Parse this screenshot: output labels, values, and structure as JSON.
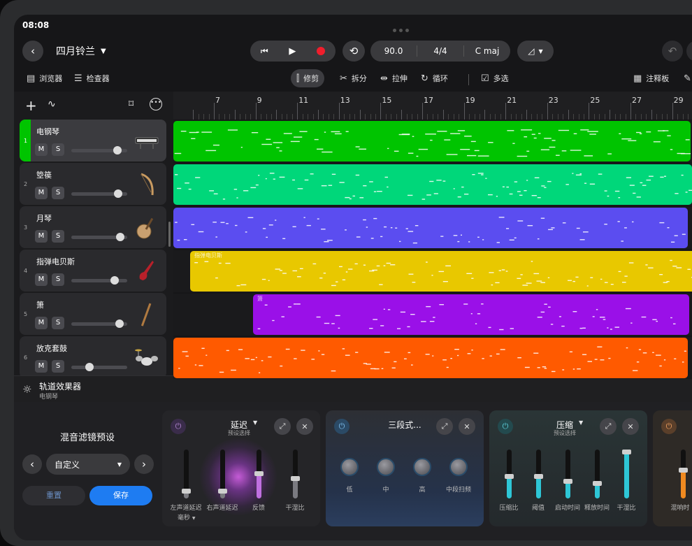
{
  "status": {
    "time": "08:08"
  },
  "project": {
    "title": "四月铃兰"
  },
  "transport": {
    "tempo": "90.0",
    "signature": "4/4",
    "key": "C maj"
  },
  "toolbar": {
    "browser": "浏览器",
    "inspector": "检查器",
    "trim": "修剪",
    "split": "拆分",
    "stretch": "拉伸",
    "loop": "循环",
    "multiselect": "多选",
    "notes": "注释板"
  },
  "ruler": {
    "bars": [
      "7",
      "9",
      "11",
      "13",
      "15",
      "17",
      "19",
      "21",
      "23",
      "25",
      "27",
      "29"
    ]
  },
  "tracks": [
    {
      "num": "1",
      "name": "电钢琴",
      "color": "#00c400",
      "volume": 0.82,
      "selected": true
    },
    {
      "num": "2",
      "name": "箜篌",
      "color": "#00d77a",
      "volume": 0.84
    },
    {
      "num": "3",
      "name": "月琴",
      "color": "#5b4df0",
      "volume": 0.88
    },
    {
      "num": "4",
      "name": "指弹电贝斯",
      "color": "#e8c800",
      "volume": 0.78
    },
    {
      "num": "5",
      "name": "箫",
      "color": "#9a10e8",
      "volume": 0.86
    },
    {
      "num": "6",
      "name": "放克套鼓",
      "color": "#ff5a00",
      "volume": 0.32
    }
  ],
  "track_buttons": {
    "mute": "M",
    "solo": "S"
  },
  "clips": [
    {
      "label": ""
    },
    {
      "label": ""
    },
    {
      "label": ""
    },
    {
      "label": "指弹电贝斯"
    },
    {
      "label": "箫"
    },
    {
      "label": ""
    }
  ],
  "fx": {
    "header_title": "轨道效果器",
    "header_sub": "电钢琴",
    "preset_title": "混音滤镜预设",
    "preset_value": "自定义",
    "reset": "重置",
    "save": "保存",
    "delay": {
      "title": "延迟",
      "sub": "预设选择",
      "labels": [
        "左声道延迟",
        "右声道延迟",
        "反馈",
        "干湿比"
      ],
      "unit": "毫秒",
      "levels": [
        0.15,
        0.15,
        0.5,
        0.4
      ]
    },
    "eq": {
      "title": "三段式...",
      "labels": [
        "低",
        "中",
        "高",
        "中段扫频"
      ]
    },
    "comp": {
      "title": "压缩",
      "sub": "预设选择",
      "labels": [
        "压缩比",
        "阈值",
        "启动时间",
        "释放时间",
        "干湿比"
      ],
      "levels": [
        0.45,
        0.45,
        0.35,
        0.3,
        1.0
      ]
    },
    "reverb": {
      "labels": [
        "混响时"
      ]
    }
  },
  "colors": {
    "accent": "#1e7cf2"
  }
}
